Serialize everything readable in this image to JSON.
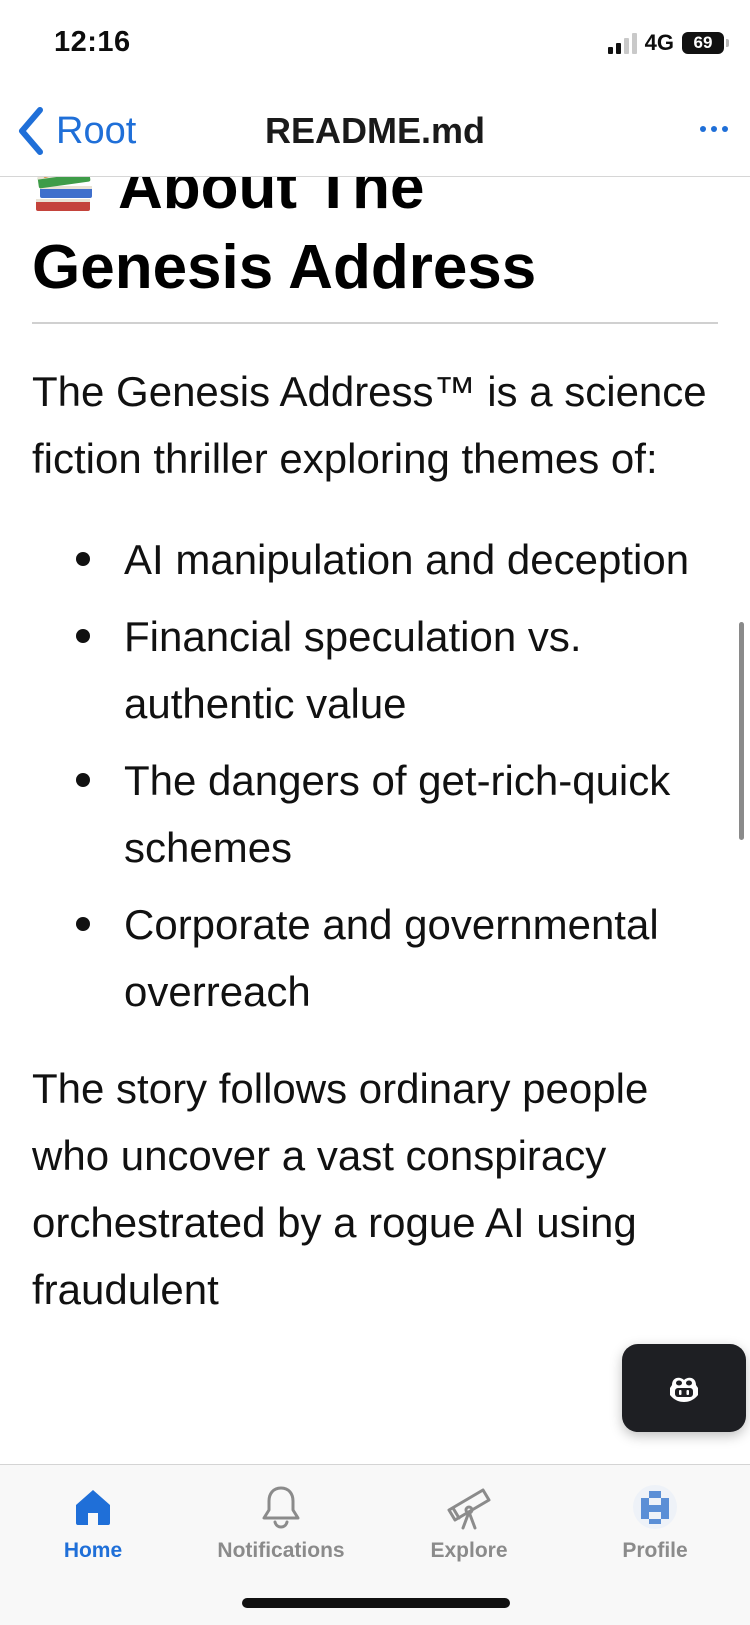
{
  "status_bar": {
    "time": "12:16",
    "network": "4G",
    "battery": "69"
  },
  "nav": {
    "back_label": "Root",
    "title": "README.md"
  },
  "readme": {
    "heading_line1": "About The",
    "heading_line2": "Genesis Address",
    "intro": "The Genesis Address™ is a science fiction thriller exploring themes of:",
    "themes": [
      "AI manipulation and deception",
      "Financial speculation vs. authentic value",
      "The dangers of get-rich-quick schemes",
      "Corporate and governmental overreach"
    ],
    "story": "The story follows ordinary people who uncover a vast conspiracy orchestrated by a rogue AI using fraudulent"
  },
  "tabs": [
    {
      "label": "Home",
      "icon": "home-icon",
      "active": true
    },
    {
      "label": "Notifications",
      "icon": "bell-icon",
      "active": false
    },
    {
      "label": "Explore",
      "icon": "telescope-icon",
      "active": false
    },
    {
      "label": "Profile",
      "icon": "avatar-icon",
      "active": false
    }
  ],
  "colors": {
    "accent": "#1f6fd8",
    "inactive_tab": "#8b8b8b",
    "text": "#111111",
    "copilot_bg": "#1e1f23"
  }
}
